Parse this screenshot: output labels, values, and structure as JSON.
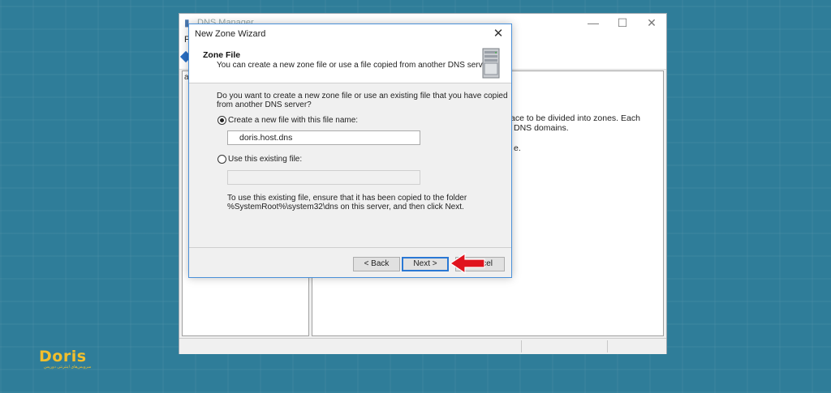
{
  "dns_manager": {
    "title": "DNS Manager",
    "menu_first": "F",
    "tree_letter": "a",
    "content_lines": [
      "ace to be divided into zones. Each",
      "DNS domains.",
      "e."
    ]
  },
  "wizard": {
    "title": "New Zone Wizard",
    "header_title": "Zone File",
    "header_subtitle": "You can create a new zone file or use a file copied from another DNS server.",
    "question_line1": "Do you want to create a new zone file or use an existing file that you have copied",
    "question_line2": "from another DNS server?",
    "option_new_label": "Create a new file with this file name:",
    "option_new_selected": true,
    "new_file_value": "doris.host.dns",
    "option_existing_label": "Use this existing file:",
    "existing_file_value": "",
    "note_line1": "To use this existing file, ensure that it has been copied to the folder",
    "note_line2": "%SystemRoot%\\system32\\dns on this server, and then click Next.",
    "back_button": "< Back",
    "next_button": "Next >",
    "cancel_button": "ncel"
  },
  "logo": {
    "wordmark": "Doris",
    "tagline": "ﺳﺮﻭیس‌های اینترنتی دوریس"
  },
  "colors": {
    "background": "#2f7d99",
    "accent_blue": "#2a78d4",
    "arrow_red": "#e0141e",
    "logo_yellow": "#f3bf2c"
  },
  "icons": [
    "dns-app-icon",
    "minimize-icon",
    "maximize-icon",
    "close-icon",
    "server-icon",
    "red-arrow-icon"
  ]
}
